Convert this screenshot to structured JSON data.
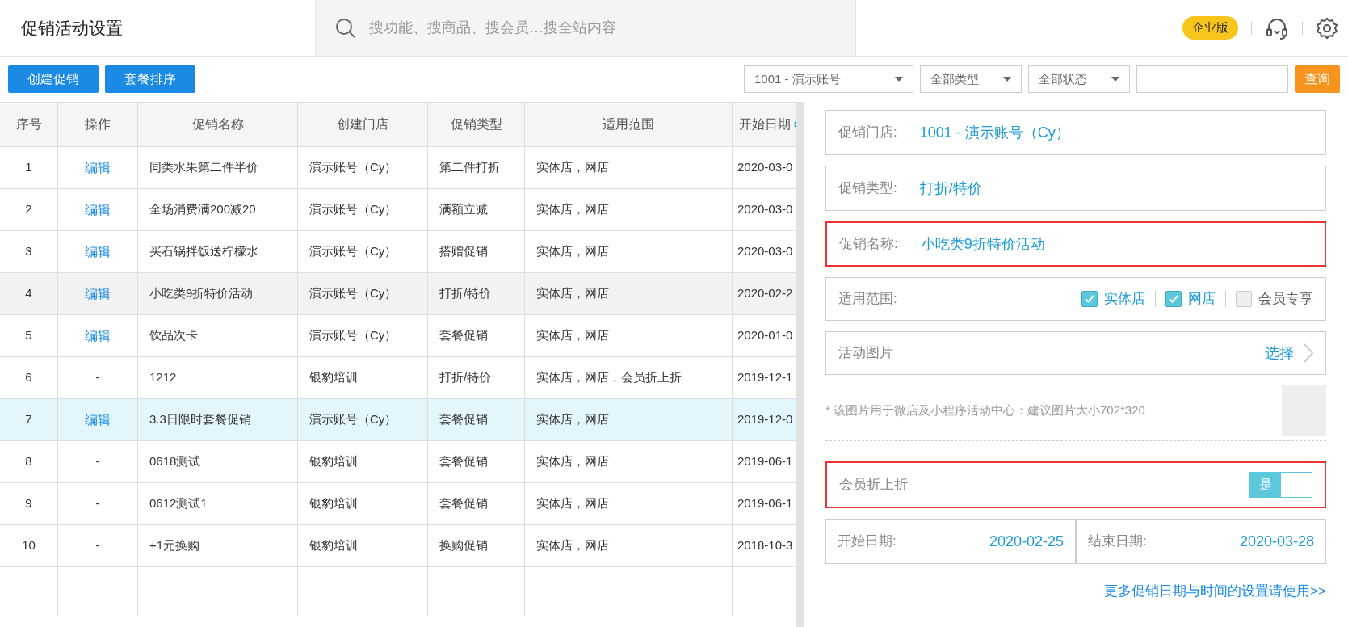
{
  "header": {
    "title": "促销活动设置",
    "search_placeholder": "搜功能、搜商品、搜会员…搜全站内容",
    "badge": "企业版"
  },
  "toolbar": {
    "buttons": [
      "创建促销",
      "套餐排序"
    ],
    "selects": [
      "1001 - 演示账号",
      "全部类型",
      "全部状态"
    ],
    "query": "查询"
  },
  "table": {
    "columns": [
      "序号",
      "操作",
      "促销名称",
      "创建门店",
      "促销类型",
      "适用范围",
      "开始日期"
    ],
    "rows": [
      {
        "no": "1",
        "action": {
          "kind": "link",
          "text": "编辑"
        },
        "name": "同类水果第二件半价",
        "store": "演示账号（Cy）",
        "type": "第二件打折",
        "scope": "实体店，网店",
        "start": "2020-03-0",
        "selected": false,
        "hovered": false
      },
      {
        "no": "2",
        "action": {
          "kind": "link",
          "text": "编辑"
        },
        "name": "全场消费满200减20",
        "store": "演示账号（Cy）",
        "type": "满额立减",
        "scope": "实体店，网店",
        "start": "2020-03-0",
        "selected": false,
        "hovered": false
      },
      {
        "no": "3",
        "action": {
          "kind": "link",
          "text": "编辑"
        },
        "name": "买石锅拌饭送柠檬水",
        "store": "演示账号（Cy）",
        "type": "搭赠促销",
        "scope": "实体店，网店",
        "start": "2020-03-0",
        "selected": false,
        "hovered": false
      },
      {
        "no": "4",
        "action": {
          "kind": "link",
          "text": "编辑"
        },
        "name": "小吃类9折特价活动",
        "store": "演示账号（Cy）",
        "type": "打折/特价",
        "scope": "实体店，网店",
        "start": "2020-02-2",
        "selected": false,
        "hovered": true
      },
      {
        "no": "5",
        "action": {
          "kind": "link",
          "text": "编辑"
        },
        "name": "饮品次卡",
        "store": "演示账号（Cy）",
        "type": "套餐促销",
        "scope": "实体店，网店",
        "start": "2020-01-0",
        "selected": false,
        "hovered": false
      },
      {
        "no": "6",
        "action": {
          "kind": "text",
          "text": "-"
        },
        "name": "1212",
        "store": "银豹培训",
        "type": "打折/特价",
        "scope": "实体店，网店，会员折上折",
        "start": "2019-12-1",
        "selected": false,
        "hovered": false
      },
      {
        "no": "7",
        "action": {
          "kind": "link",
          "text": "编辑"
        },
        "name": "3.3日限时套餐促销",
        "store": "演示账号（Cy）",
        "type": "套餐促销",
        "scope": "实体店，网店",
        "start": "2019-12-0",
        "selected": true,
        "hovered": false
      },
      {
        "no": "8",
        "action": {
          "kind": "text",
          "text": "-"
        },
        "name": "0618测试",
        "store": "银豹培训",
        "type": "套餐促销",
        "scope": "实体店，网店",
        "start": "2019-06-1",
        "selected": false,
        "hovered": false
      },
      {
        "no": "9",
        "action": {
          "kind": "text",
          "text": "-"
        },
        "name": "0612测试1",
        "store": "银豹培训",
        "type": "套餐促销",
        "scope": "实体店，网店",
        "start": "2019-06-1",
        "selected": false,
        "hovered": false
      },
      {
        "no": "10",
        "action": {
          "kind": "text",
          "text": "-"
        },
        "name": "+1元换购",
        "store": "银豹培训",
        "type": "换购促销",
        "scope": "实体店，网店",
        "start": "2018-10-3",
        "selected": false,
        "hovered": false
      }
    ]
  },
  "panel": {
    "fields": [
      {
        "label": "促销门店:",
        "value": "1001 - 演示账号（Cy）",
        "highlighted": false
      },
      {
        "label": "促销类型:",
        "value": "打折/特价",
        "highlighted": false
      },
      {
        "label": "促销名称:",
        "value": "小吃类9折特价活动",
        "highlighted": true
      }
    ],
    "scope": {
      "label": "适用范围:",
      "options": [
        {
          "label": "实体店",
          "checked": true
        },
        {
          "label": "网店",
          "checked": true
        },
        {
          "label": "会员专享",
          "checked": false
        }
      ]
    },
    "image": {
      "label": "活动图片",
      "action": "选择",
      "note": "* 该图片用于微店及小程序活动中心：建议图片大小702*320"
    },
    "member": {
      "label": "会员折上折",
      "toggle_label": "是",
      "on": true,
      "highlighted": true
    },
    "dates": [
      {
        "label": "开始日期:",
        "value": "2020-02-25"
      },
      {
        "label": "结束日期:",
        "value": "2020-03-28"
      }
    ],
    "link": "更多促销日期与时间的设置请使用>>"
  }
}
